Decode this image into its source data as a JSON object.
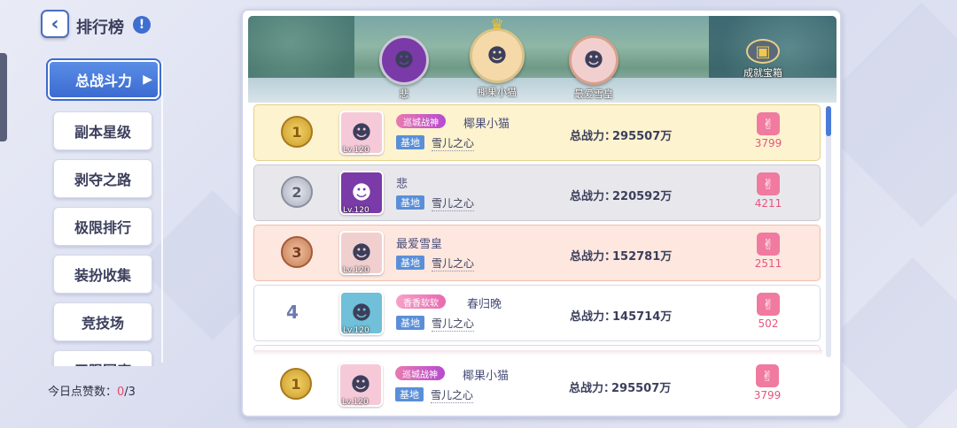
{
  "header": {
    "title": "排行榜",
    "info_icon": "!"
  },
  "sidebar": {
    "items": [
      {
        "label": "总战斗力",
        "active": true
      },
      {
        "label": "副本星级"
      },
      {
        "label": "剥夺之路"
      },
      {
        "label": "极限排行"
      },
      {
        "label": "装扮收集"
      },
      {
        "label": "竞技场"
      },
      {
        "label": "无限回廊"
      }
    ],
    "likes_today_label": "今日点赞数：",
    "likes_today_used": "0",
    "likes_today_total": "/3"
  },
  "banner": {
    "podium": [
      {
        "name": "悲",
        "place": 2,
        "frame_color": "#a060c0"
      },
      {
        "name": "椰果小猫",
        "place": 1,
        "frame_color": "#f0c060"
      },
      {
        "name": "最爱雪皇",
        "place": 3,
        "frame_color": "#e69a8a"
      }
    ],
    "chest_label": "成就宝箱"
  },
  "list": {
    "power_label": "总战力：",
    "base_tag": "基地",
    "rows": [
      {
        "rank": "1",
        "medal": "gold",
        "level": "Lv.120",
        "title_badge": "巡城战神",
        "name": "椰果小猫",
        "guild": "雪儿之心",
        "power": "295507万",
        "likes": "3799",
        "avatar_color": "#f6c9d8"
      },
      {
        "rank": "2",
        "medal": "silver",
        "level": "Lv.120",
        "title_badge": "",
        "name": "悲",
        "guild": "雪儿之心",
        "power": "220592万",
        "likes": "4211",
        "avatar_color": "#7a3aa8"
      },
      {
        "rank": "3",
        "medal": "bronze",
        "level": "Lv.120",
        "title_badge": "",
        "name": "最爱雪皇",
        "guild": "雪儿之心",
        "power": "152781万",
        "likes": "2511",
        "avatar_color": "#f2cfcf"
      },
      {
        "rank": "4",
        "medal": "none",
        "level": "Lv.120",
        "title_badge": "香香软软",
        "name": "春归晚",
        "guild": "雪儿之心",
        "power": "145714万",
        "likes": "502",
        "avatar_color": "#6fc0d8"
      }
    ],
    "self": {
      "rank": "1",
      "medal": "gold",
      "level": "Lv.120",
      "title_badge": "巡城战神",
      "name": "椰果小猫",
      "guild": "雪儿之心",
      "power": "295507万",
      "likes": "3799",
      "avatar_color": "#f6c9d8"
    }
  },
  "icons": {
    "back": "chevron-left-icon",
    "like": "thumbs-up-icon",
    "crown": "crown-icon",
    "chest": "treasure-chest-icon"
  }
}
